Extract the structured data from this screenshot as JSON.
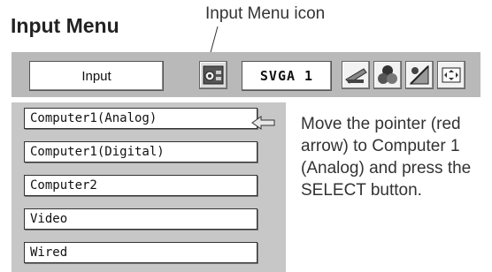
{
  "heading": "Input Menu",
  "callout": "Input Menu icon",
  "menubar": {
    "input_title": "Input",
    "signal_label": "SVGA 1",
    "icons": [
      "input-menu-icon",
      "screen-adjust-icon",
      "color-adjust-icon",
      "image-adjust-icon",
      "setting-icon"
    ]
  },
  "menu": {
    "items": [
      {
        "label": "Computer1(Analog)"
      },
      {
        "label": "Computer1(Digital)"
      },
      {
        "label": "Computer2"
      },
      {
        "label": "Video"
      },
      {
        "label": "Wired"
      }
    ],
    "pointer": "red-arrow-pointer-icon"
  },
  "instruction": "Move the pointer (red arrow) to Computer 1 (Analog) and press the SELECT button."
}
